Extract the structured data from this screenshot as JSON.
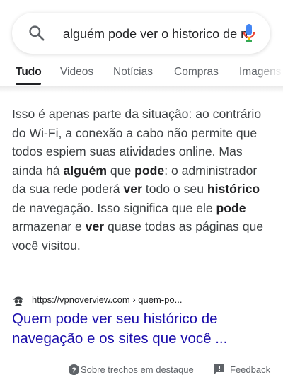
{
  "search": {
    "query": "alguém pode ver o historico de navegação"
  },
  "tabs": [
    {
      "label": "Tudo",
      "active": true
    },
    {
      "label": "Videos"
    },
    {
      "label": "Notícias"
    },
    {
      "label": "Compras"
    },
    {
      "label": "Imagens"
    }
  ],
  "snippet": {
    "segments": [
      {
        "text": "Isso é apenas parte da situação: ao contrário do Wi-Fi, a conexão a cabo não permite que todos espiem suas atividades online. Mas ainda há ",
        "bold": false
      },
      {
        "text": "alguém",
        "bold": true
      },
      {
        "text": " que ",
        "bold": false
      },
      {
        "text": "pode",
        "bold": true
      },
      {
        "text": ": o administrador da sua rede poderá ",
        "bold": false
      },
      {
        "text": "ver",
        "bold": true
      },
      {
        "text": " todo o seu ",
        "bold": false
      },
      {
        "text": "histórico",
        "bold": true
      },
      {
        "text": " de navegação. Isso significa que ele ",
        "bold": false
      },
      {
        "text": "pode",
        "bold": true
      },
      {
        "text": " armazenar e ",
        "bold": false
      },
      {
        "text": "ver",
        "bold": true
      },
      {
        "text": " quase todas as páginas que você visitou.",
        "bold": false
      }
    ]
  },
  "result": {
    "url": "https://vpnoverview.com › quem-po...",
    "title": "Quem pode ver seu histórico de navegação e os sites que você ..."
  },
  "footer": {
    "about_label": "Sobre trechos em destaque",
    "feedback_label": "Feedback"
  },
  "icons": {
    "search": "search-icon",
    "mic": "microphone-icon",
    "favicon": "spy-favicon-icon",
    "help": "help-circle-icon",
    "feedback": "feedback-icon"
  },
  "colors": {
    "link": "#1a0dab",
    "text": "#3c4043",
    "secondary": "#5f6368",
    "mic_blue": "#4285f4",
    "mic_red": "#ea4335",
    "mic_yellow": "#fbbc05",
    "mic_green": "#34a853"
  }
}
